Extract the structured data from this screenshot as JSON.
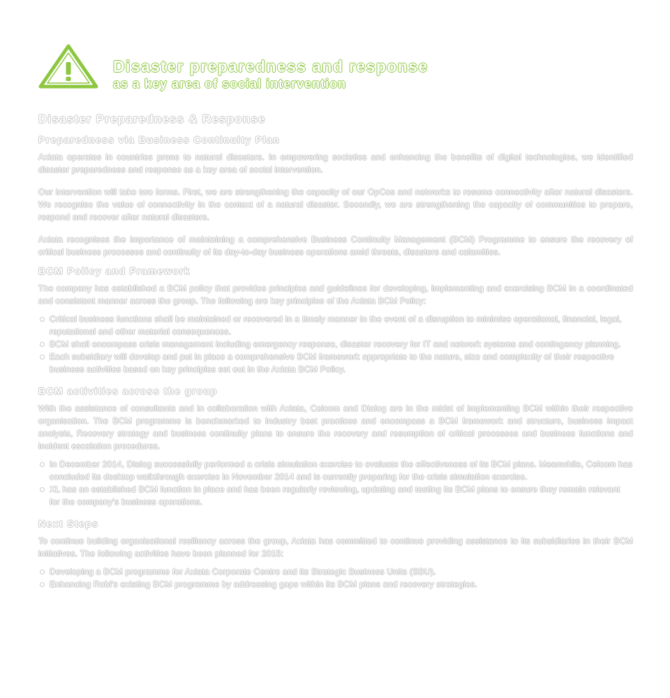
{
  "colors": {
    "accent": "#8dc63f",
    "text_outline": "#c9c9c9",
    "background": "#ffffff"
  },
  "header": {
    "icon": "warning-triangle-icon",
    "title": "Disaster preparedness and response",
    "subtitle": "as a key area of social intervention"
  },
  "sections": {
    "main_heading": "Disaster Preparedness & Response",
    "preparedness": {
      "heading": "Preparedness via Business Continuity Plan",
      "p1": "Axiata operates in countries prone to natural disasters. In empowering societies and enhancing the benefits of digital technologies, we identified disaster preparedness and response as a key area of social intervention.",
      "p2": "Our intervention will take two forms. First, we are strengthening the capacity of our OpCos and networks to resume connectivity after natural disasters. We recognise the value of connectivity in the context of a natural disaster. Secondly, we are strengthening the capacity of communities to prepare, respond and recover after natural disasters.",
      "p3": "Axiata recognises the importance of maintaining a comprehensive Business Continuity Management (BCM) Programme to ensure the recovery of critical business processes and continuity of its day-to-day business operations amid threats, disasters and calamities."
    },
    "policy": {
      "heading": "BCM Policy and Framework",
      "intro": "The company has established a BCM policy that provides principles and guidelines for developing, implementing and exercising BCM in a coordinated and consistent manner across the group. The following are key principles of the Axiata BCM Policy:",
      "bullets": [
        "Critical business functions shall be maintained or recovered in a timely manner in the event of a disruption to minimise operational, financial, legal, reputational and other material consequences.",
        "BCM shall encompass crisis management including emergency response, disaster recovery for IT and network systems and contingency planning.",
        "Each subsidiary will develop and put in place a comprehensive BCM framework appropriate to the nature, size and complexity of their respective business activities based on key principles set out in the Axiata BCM Policy."
      ]
    },
    "activities": {
      "heading": "BCM activities across the group",
      "intro": "With the assistance of consultants and in collaboration with Axiata, Celcom and Dialog are in the midst of implementing BCM within their respective organisation. The BCM programme is benchmarked to industry best practices and encompass a BCM framework and structure, business impact analysis, Recovery strategy and business continuity plans to ensure the recovery and resumption of critical processes and business functions and incident escalation procedures.",
      "bullets": [
        "In December 2014, Dialog successfully performed a crisis simulation exercise to evaluate the effectiveness of its BCM plans. Meanwhile, Celcom has concluded its desktop walkthrough exercise in November 2014 and is currently preparing for the crisis simulation exercise.",
        "XL has an established BCM function in place and has been regularly reviewing, updating and testing its BCM plans to ensure they remain relevant for the company's business operations."
      ]
    },
    "next_steps": {
      "heading": "Next Steps",
      "intro": "To continue building organisational resiliency across the group, Axiata has committed to continue providing assistance to its subsidiaries in their BCM initiatives. The following activities have been planned for 2015:",
      "bullets": [
        "Developing a BCM programme for Axiata Corporate Centre and its Strategic Business Units (SBU).",
        "Enhancing Robi's existing BCM programme by addressing gaps within its BCM plans and recovery strategies."
      ]
    }
  }
}
